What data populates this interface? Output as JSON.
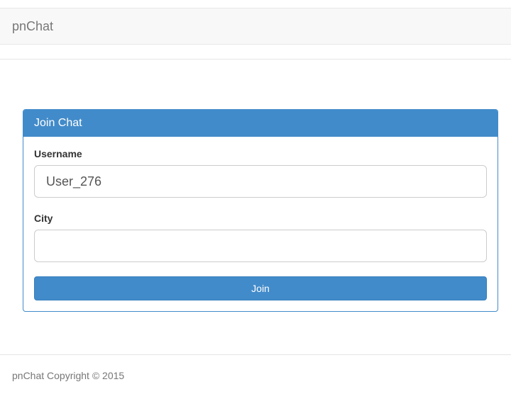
{
  "navbar": {
    "brand": "pnChat"
  },
  "join_panel": {
    "title": "Join Chat",
    "username_label": "Username",
    "username_value": "User_276",
    "city_label": "City",
    "city_value": "",
    "join_button_label": "Join"
  },
  "footer": {
    "copyright": "pnChat Copyright © 2015"
  },
  "colors": {
    "primary": "#428bca",
    "navbar_bg": "#f8f8f8",
    "muted_text": "#777777"
  }
}
